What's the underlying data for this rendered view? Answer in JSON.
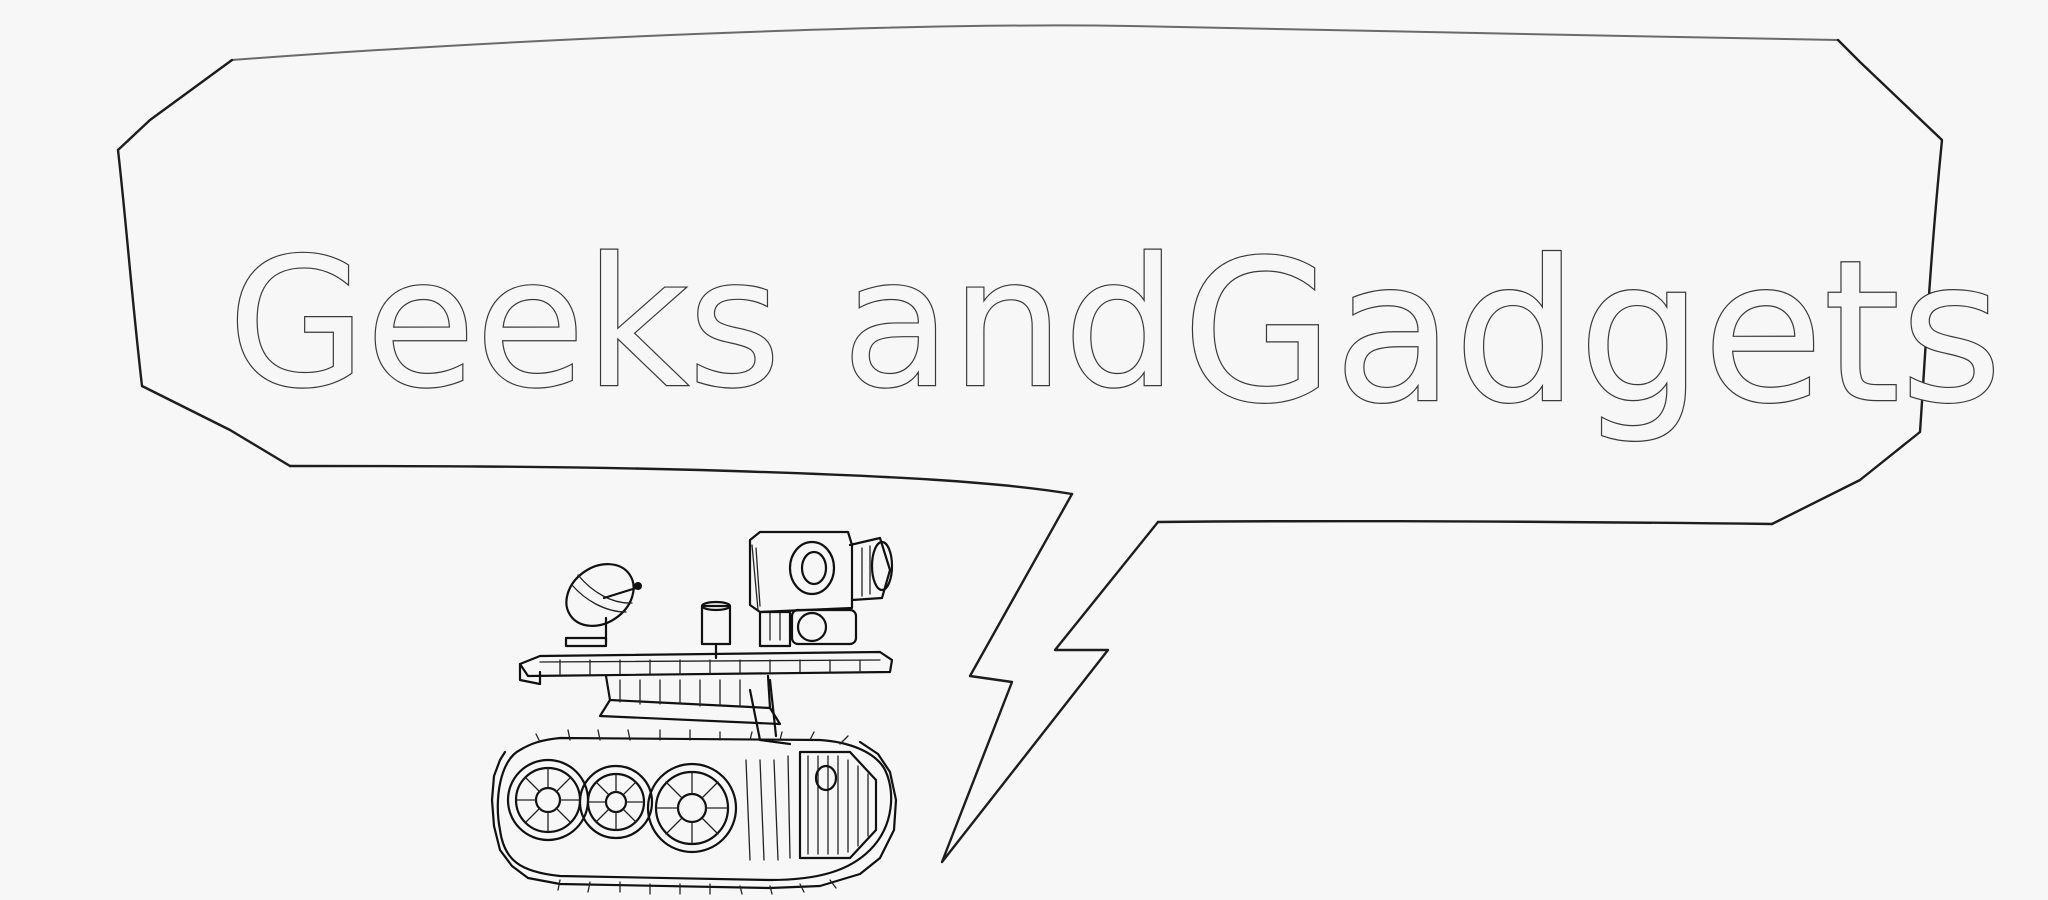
{
  "bubble": {
    "title_word_1": "Geeks",
    "title_word_2": "and",
    "title_word_3": "Gadgets"
  },
  "colors": {
    "background": "#f7f7f7",
    "ink": "#111111",
    "pencil": "#4a4a4a"
  },
  "icons": {
    "robot": "robot-rover-sketch",
    "lightning": "lightning-bolt-tail"
  }
}
